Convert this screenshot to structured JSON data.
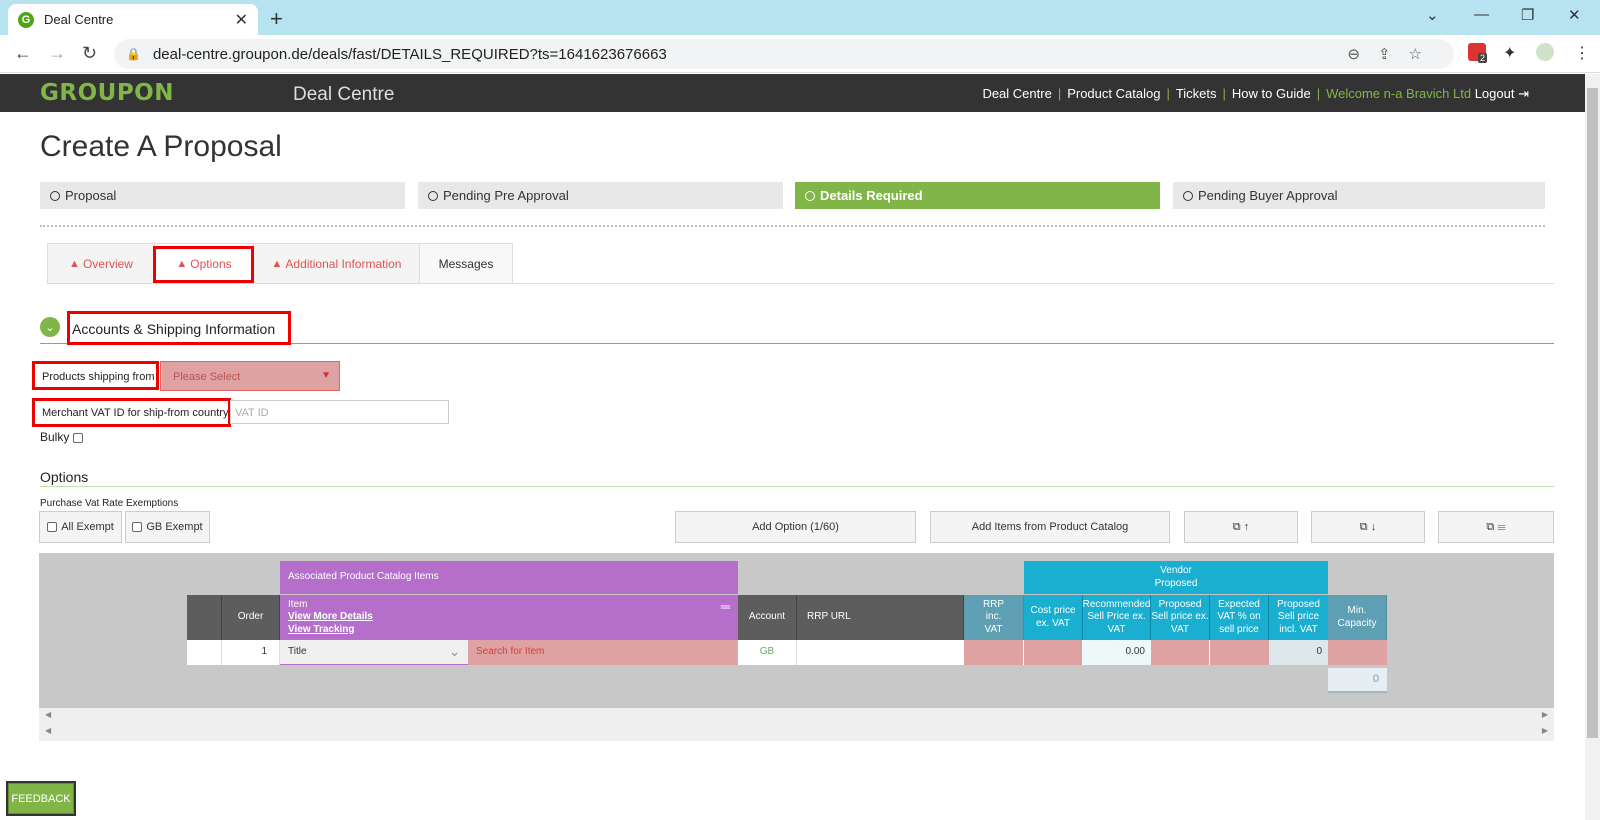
{
  "browser": {
    "tab_title": "Deal Centre",
    "url": "deal-centre.groupon.de/deals/fast/DETAILS_REQUIRED?ts=1641623676663",
    "ext_badge": "2"
  },
  "header": {
    "logo": "GROUPON",
    "app_title": "Deal Centre",
    "nav": [
      "Deal Centre",
      "Product Catalog",
      "Tickets",
      "How to Guide"
    ],
    "welcome": "Welcome n-a Bravich Ltd",
    "logout": "Logout"
  },
  "page": {
    "title": "Create A Proposal",
    "steps": [
      "Proposal",
      "Pending Pre Approval",
      "Details Required",
      "Pending Buyer Approval"
    ],
    "tabs": [
      "Overview",
      "Options",
      "Additional Information",
      "Messages"
    ]
  },
  "accounts": {
    "section_title": "Accounts & Shipping Information",
    "ship_from_label": "Products shipping from",
    "ship_from_placeholder": "Please Select",
    "vat_label": "Merchant VAT ID for ship-from country",
    "vat_placeholder": "VAT ID",
    "bulky_label": "Bulky"
  },
  "options": {
    "section_title": "Options",
    "exemptions_label": "Purchase Vat Rate Exemptions",
    "all_exempt": "All Exempt",
    "gb_exempt": "GB Exempt",
    "add_option": "Add Option (1/60)",
    "add_catalog": "Add Items from Product Catalog",
    "copy_up": "⧉ ↑",
    "copy_down": "⧉ ↓",
    "copy_list": "⧉ ☰"
  },
  "table": {
    "group_catalog": "Associated Product Catalog Items",
    "group_vendor_1": "Vendor",
    "group_vendor_2": "Proposed",
    "col_order": "Order",
    "col_item": "Item",
    "link_details": "View More Details",
    "link_tracking": "View Tracking",
    "col_account": "Account",
    "col_rrp_url": "RRP URL",
    "col_rrp": "RRP inc. VAT",
    "col_cost": "Cost price ex. VAT",
    "col_rec_sell": "Recommended Sell Price ex. VAT",
    "col_prop_sell": "Proposed Sell price ex. VAT",
    "col_exp_vat": "Expected VAT % on sell price",
    "col_prop_incl": "Proposed Sell price incl. VAT",
    "col_min_cap": "Min. Capacity",
    "row_order": "1",
    "row_title": "Title",
    "row_search": "Search for Item",
    "row_account": "GB",
    "row_rec_sell": "0.00",
    "row_prop_incl": "0",
    "total_capacity": "0"
  },
  "feedback": "FEEDBACK"
}
